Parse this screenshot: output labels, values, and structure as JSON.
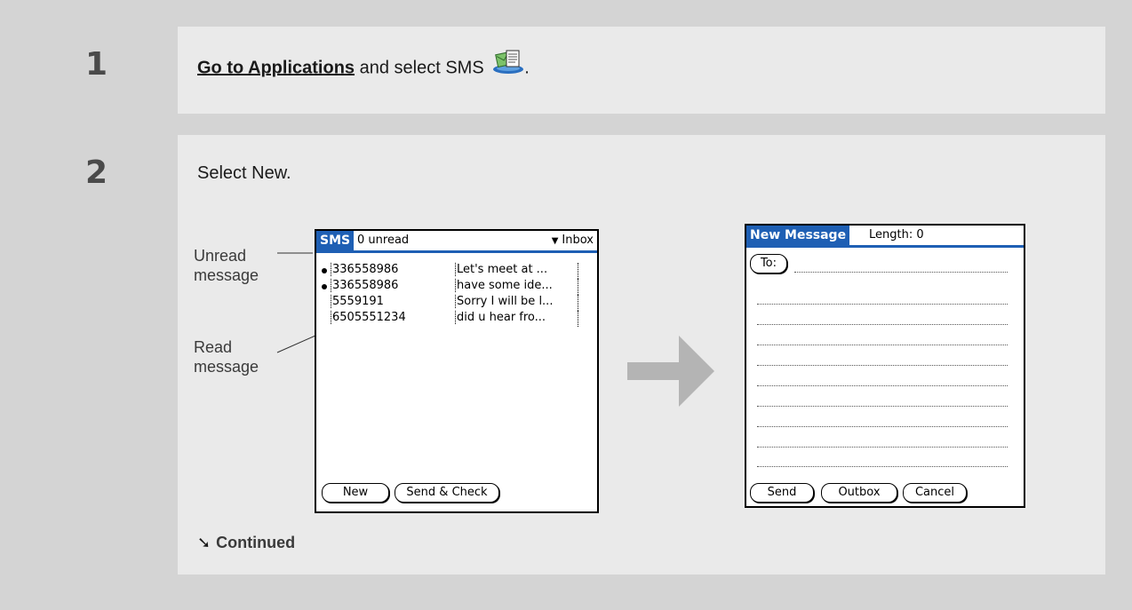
{
  "steps": [
    {
      "number": "1",
      "link_text": "Go to Applications",
      "text": " and select SMS ",
      "suffix": ".",
      "icon": "sms-app-icon"
    },
    {
      "number": "2",
      "text": "Select New.",
      "callouts": {
        "unread": [
          "Unread",
          "message"
        ],
        "read": [
          "Read",
          "message"
        ]
      },
      "inbox_screen": {
        "tab": "SMS",
        "unread_count": "0 unread",
        "folder": "Inbox",
        "folder_arrow": "▼",
        "rows": [
          {
            "unread": true,
            "number": "336558986",
            "message": "Let's meet at ..."
          },
          {
            "unread": true,
            "number": "336558986",
            "message": "have some ide..."
          },
          {
            "unread": false,
            "number": "5559191",
            "message": "Sorry I will be l..."
          },
          {
            "unread": false,
            "number": "6505551234",
            "message": "did u hear fro..."
          }
        ],
        "buttons": [
          "New",
          "Send & Check"
        ]
      },
      "new_message_screen": {
        "tab": "New Message",
        "length": "Length: 0",
        "to_button": "To:",
        "buttons": [
          "Send",
          "Outbox",
          "Cancel"
        ]
      },
      "continued": "Continued",
      "continued_arrow": "➘"
    }
  ],
  "colors": {
    "tab_blue": "#1e5fb4",
    "arrow_gray": "#b4b4b4",
    "panel": "#eaeaea",
    "frame": "#d4d4d4"
  }
}
